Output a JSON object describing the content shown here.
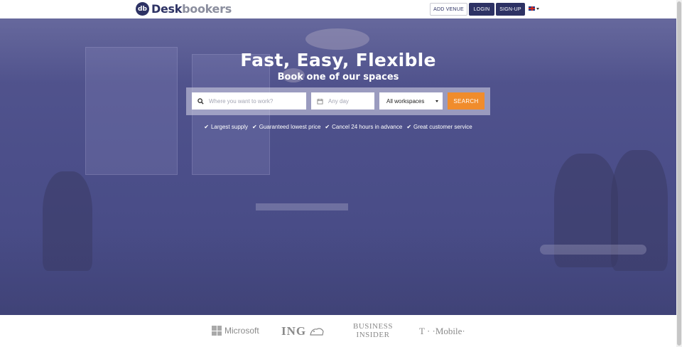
{
  "header": {
    "logo_abbr": "db",
    "logo_part1": "Desk",
    "logo_part2": "bookers",
    "add_venue_label": "ADD VENUE",
    "login_label": "LOGIN",
    "signup_label": "SIGN-UP",
    "language_icon": "uk-flag-icon"
  },
  "hero": {
    "title": "Fast, Easy, Flexible",
    "subtitle": "Book one of our spaces",
    "search": {
      "where_placeholder": "Where you want to work?",
      "day_placeholder": "Any day",
      "workspace_selected": "All workspaces",
      "search_label": "SEARCH"
    },
    "features": [
      "Largest supply",
      "Guaranteed lowest price",
      "Cancel 24 hours in advance",
      "Great customer service"
    ]
  },
  "brands": {
    "microsoft": "Microsoft",
    "ing": "ING",
    "business_insider_line1": "BUSINESS",
    "business_insider_line2": "INSIDER",
    "tmobile": "T · ·Mobile·"
  },
  "colors": {
    "brand_navy": "#2d3264",
    "accent_orange": "#f08c2c",
    "hero_overlay": "#4c4f8a"
  }
}
